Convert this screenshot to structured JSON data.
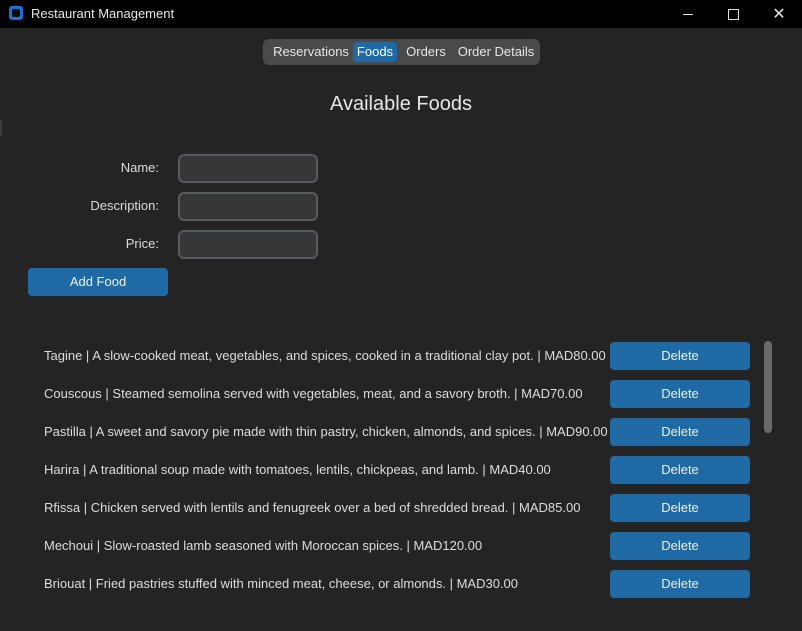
{
  "window": {
    "title": "Restaurant Management",
    "controls": {
      "minimize": "",
      "maximize": "",
      "close": "✕"
    }
  },
  "tabs": [
    {
      "label": "Reservations",
      "active": false
    },
    {
      "label": "Foods",
      "active": true
    },
    {
      "label": "Orders",
      "active": false
    },
    {
      "label": "Order Details",
      "active": false
    }
  ],
  "page": {
    "heading": "Available Foods"
  },
  "form": {
    "name_label": "Name:",
    "description_label": "Description:",
    "price_label": "Price:",
    "name_value": "",
    "description_value": "",
    "price_value": "",
    "add_button": "Add Food"
  },
  "foods": [
    {
      "text": "Tagine | A slow-cooked meat, vegetables, and spices, cooked in a traditional clay pot. | MAD80.00",
      "delete_label": "Delete"
    },
    {
      "text": "Couscous | Steamed semolina served with vegetables, meat, and a savory broth. | MAD70.00",
      "delete_label": "Delete"
    },
    {
      "text": "Pastilla | A sweet and savory pie made with thin pastry, chicken, almonds, and spices. | MAD90.00",
      "delete_label": "Delete"
    },
    {
      "text": "Harira | A traditional soup made with tomatoes, lentils, chickpeas, and lamb. | MAD40.00",
      "delete_label": "Delete"
    },
    {
      "text": "Rfissa | Chicken served with lentils and fenugreek over a bed of shredded bread. | MAD85.00",
      "delete_label": "Delete"
    },
    {
      "text": "Mechoui | Slow-roasted lamb seasoned with Moroccan spices. | MAD120.00",
      "delete_label": "Delete"
    },
    {
      "text": "Briouat | Fried pastries stuffed with minced meat, cheese, or almonds. | MAD30.00",
      "delete_label": "Delete"
    }
  ],
  "colors": {
    "accent": "#1f6aa5",
    "background": "#242424",
    "titlebar": "#000000"
  }
}
